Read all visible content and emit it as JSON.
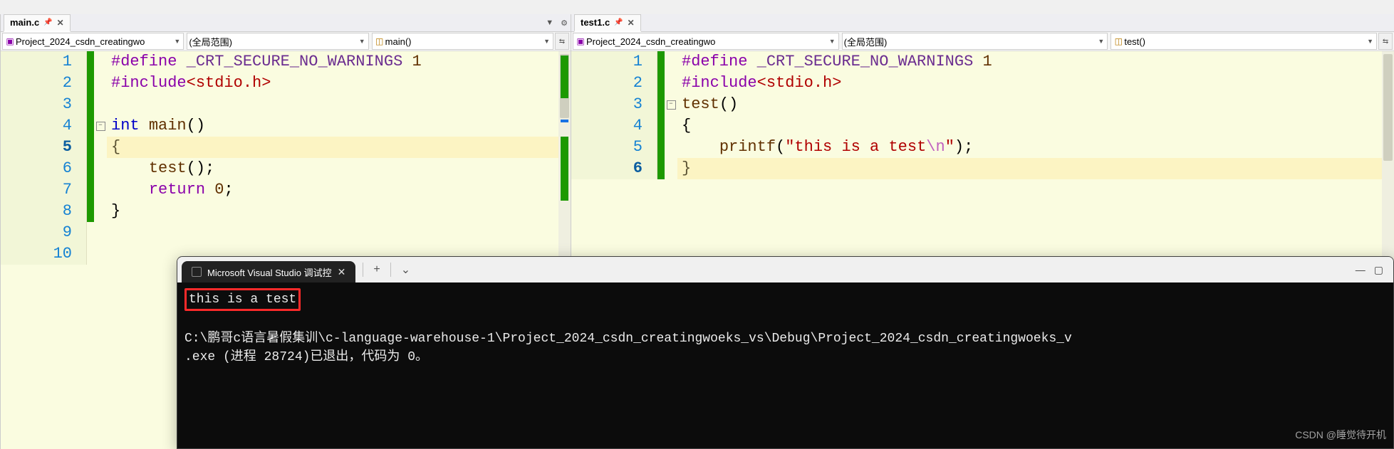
{
  "left": {
    "tab": {
      "label": "main.c"
    },
    "combo1": "Project_2024_csdn_creatingwo",
    "combo2": "(全局范围)",
    "combo3": "main()",
    "lines": [
      {
        "n": "1",
        "html": "<span class='tok-pp'>#define</span> <span class='tok-macro'>_CRT_SECURE_NO_WARNINGS</span> <span class='tok-num'>1</span>"
      },
      {
        "n": "2",
        "html": "<span class='tok-pp'>#include</span><span class='tok-angle'>&lt;stdio.h&gt;</span>"
      },
      {
        "n": "3",
        "html": ""
      },
      {
        "n": "4",
        "html": "<span class='tok-kw'>int</span> <span class='tok-id'>main</span>()",
        "fold": true
      },
      {
        "n": "5",
        "html": "{",
        "cur": true
      },
      {
        "n": "6",
        "html": "    <span class='tok-id'>test</span>();"
      },
      {
        "n": "7",
        "html": "    <span class='tok-pp'>return</span> <span class='tok-num'>0</span>;"
      },
      {
        "n": "8",
        "html": "}"
      },
      {
        "n": "9",
        "html": "",
        "nogreen": true
      },
      {
        "n": "10",
        "html": "",
        "nogreen": true
      }
    ]
  },
  "right": {
    "tab": {
      "label": "test1.c"
    },
    "combo1": "Project_2024_csdn_creatingwo",
    "combo2": "(全局范围)",
    "combo3": "test()",
    "lines": [
      {
        "n": "1",
        "html": "<span class='tok-pp'>#define</span> <span class='tok-macro'>_CRT_SECURE_NO_WARNINGS</span> <span class='tok-num'>1</span>"
      },
      {
        "n": "2",
        "html": "<span class='tok-pp'>#include</span><span class='tok-angle'>&lt;stdio.h&gt;</span>"
      },
      {
        "n": "3",
        "html": "<span class='tok-id'>test</span>()",
        "fold": true
      },
      {
        "n": "4",
        "html": "{"
      },
      {
        "n": "5",
        "html": "    <span class='tok-id'>printf</span>(<span class='tok-str'>\"this is a test</span><span class='tok-esc'>\\n</span><span class='tok-str'>\"</span>);"
      },
      {
        "n": "6",
        "html": "}",
        "cur": true
      }
    ]
  },
  "console": {
    "tab_title": "Microsoft Visual Studio 调试控",
    "line1": "this is a test",
    "line2": "C:\\鹏哥c语言暑假集训\\c-language-warehouse-1\\Project_2024_csdn_creatingwoeks_vs\\Debug\\Project_2024_csdn_creatingwoeks_v",
    "line3": ".exe (进程 28724)已退出，代码为 0。",
    "watermark": "CSDN @睡觉待开机"
  }
}
